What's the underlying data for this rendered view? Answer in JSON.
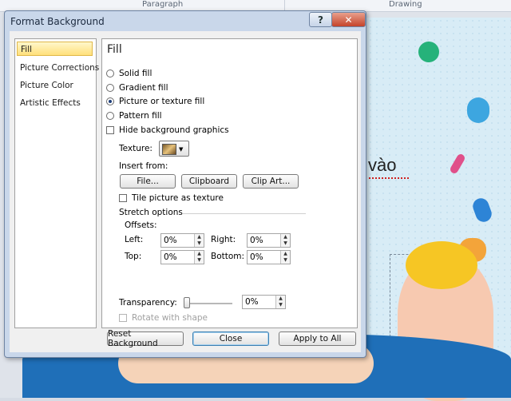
{
  "ribbon": {
    "group_paragraph": "Paragraph",
    "group_drawing": "Drawing"
  },
  "slide": {
    "title_fragment": "vào"
  },
  "dialog": {
    "title": "Format Background",
    "help_label": "?",
    "close_label": "✕",
    "nav": [
      "Fill",
      "Picture Corrections",
      "Picture Color",
      "Artistic Effects"
    ],
    "section_title": "Fill",
    "fill_options": [
      "Solid fill",
      "Gradient fill",
      "Picture or texture fill",
      "Pattern fill"
    ],
    "selected_fill": "Picture or texture fill",
    "hide_bg_label": "Hide background graphics",
    "texture_label": "Texture:",
    "insert_from_label": "Insert from:",
    "file_btn": "File...",
    "clipboard_btn": "Clipboard",
    "clipart_btn": "Clip Art...",
    "tile_label": "Tile picture as texture",
    "stretch_label": "Stretch options",
    "offsets_label": "Offsets:",
    "left_label": "Left:",
    "right_label": "Right:",
    "top_label": "Top:",
    "bottom_label": "Bottom:",
    "offset_left": "0%",
    "offset_right": "0%",
    "offset_top": "0%",
    "offset_bottom": "0%",
    "transparency_label": "Transparency:",
    "transparency_value": "0%",
    "rotate_label": "Rotate with shape",
    "reset_btn": "Reset Background",
    "close_btn": "Close",
    "apply_all_btn": "Apply to All"
  }
}
